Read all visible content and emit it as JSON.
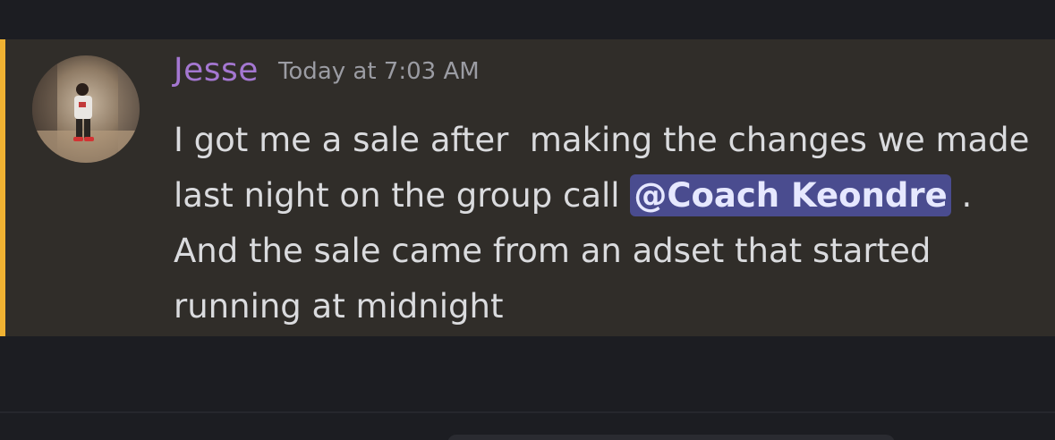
{
  "message": {
    "author": {
      "name": "Jesse",
      "color": "#a477d1"
    },
    "timestamp": "Today at 7:03 AM",
    "highlight_color": "#f0b232",
    "content": {
      "text_1": "I got me a sale after  making the changes we made last night on the group call ",
      "mention": "@Coach Keondre",
      "text_2": " . And the sale came from an adset that started running at midnight"
    },
    "avatar_icon": "user-avatar-photo"
  }
}
